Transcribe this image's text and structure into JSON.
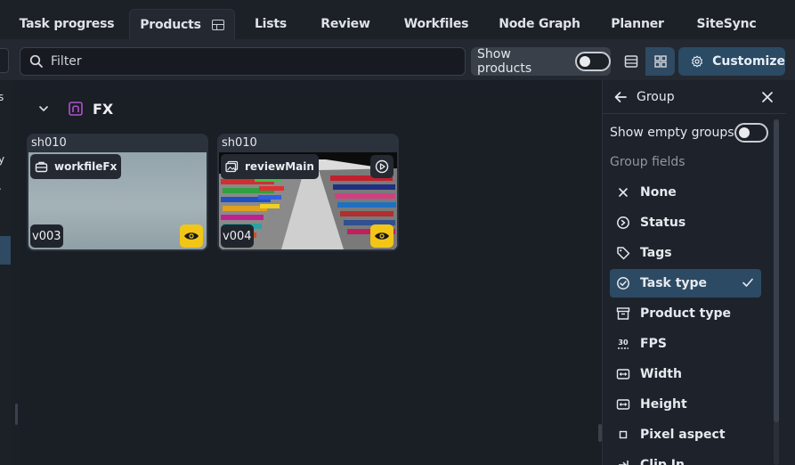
{
  "tabs": [
    "Task progress",
    "Products",
    "Lists",
    "Review",
    "Workfiles",
    "Node Graph",
    "Planner",
    "SiteSync"
  ],
  "toolbar": {
    "filter_placeholder": "Filter",
    "show_products_label": "Show products",
    "customize_label": "Customize"
  },
  "left_strip": [
    "s",
    "y",
    "."
  ],
  "group": {
    "name": "FX"
  },
  "cards": [
    {
      "shot": "sh010",
      "label": "workfileFx",
      "version": "v003"
    },
    {
      "shot": "sh010",
      "label": "reviewMain",
      "version": "v004"
    }
  ],
  "panel": {
    "title": "Group",
    "show_empty_label": "Show empty groups",
    "fields_label": "Group fields",
    "options": [
      "None",
      "Status",
      "Tags",
      "Task type",
      "Product type",
      "FPS",
      "Width",
      "Height",
      "Pixel aspect",
      "Clip In"
    ],
    "selected": "Task type"
  },
  "colors": {
    "accent": "#2c4a64",
    "eye_badge": "#f2c617",
    "group_icon": "#b050d0"
  }
}
